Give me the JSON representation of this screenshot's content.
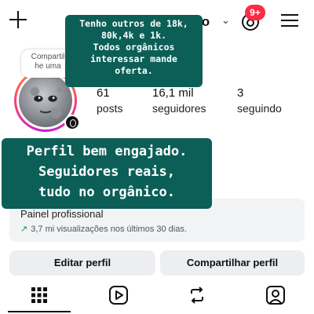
{
  "header": {
    "username_visible": "io",
    "notification_badge": "9+"
  },
  "overlays": {
    "top_caption": "Tenho outros de 18k,\n80k,4k e 1k.\nTodos orgânicos\ninteressar mande\noferta.",
    "mid_caption": "Perfil bem engajado.\nSeguidores reais,\ntudo no orgânico."
  },
  "profile": {
    "note": "Compartil he uma",
    "partial_label": "o",
    "stats": [
      {
        "value": "61",
        "label": "posts"
      },
      {
        "value": "16,1 mil",
        "label": "seguidores"
      },
      {
        "value": "3",
        "label": "seguindo"
      }
    ]
  },
  "dashboard": {
    "title": "Painel profissional",
    "insight": "3,7 mi visualizações nos últimos 30 dias."
  },
  "actions": {
    "edit": "Editar perfil",
    "share": "Compartilhar perfil"
  },
  "tabs": [
    {
      "icon": "grid-icon",
      "active": true
    },
    {
      "icon": "reels-icon",
      "active": false
    },
    {
      "icon": "reposts-icon",
      "active": false
    },
    {
      "icon": "tagged-icon",
      "active": false
    }
  ],
  "colors": {
    "overlay_bg": "#0b5f57",
    "badge": "#ff2a44",
    "trend": "#1d8f3a"
  }
}
